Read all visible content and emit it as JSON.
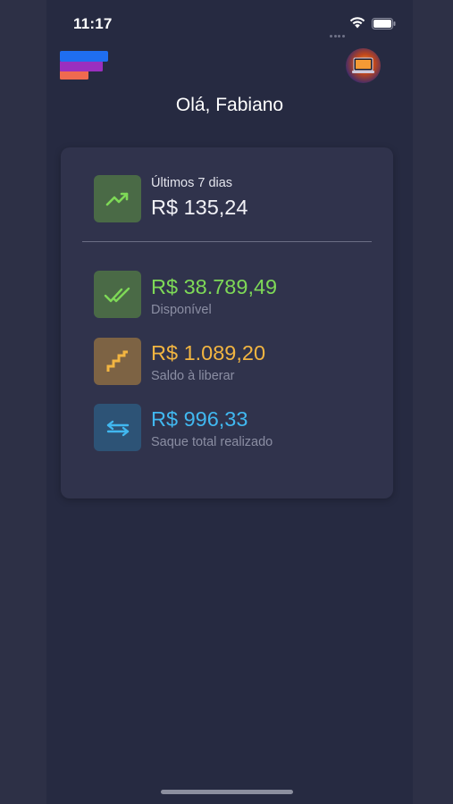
{
  "status_bar": {
    "time": "11:17"
  },
  "header": {
    "greeting": "Olá, Fabiano"
  },
  "summary": {
    "period_label": "Últimos 7 dias",
    "period_value": "R$ 135,24"
  },
  "balances": [
    {
      "value": "R$ 38.789,49",
      "label": "Disponível",
      "color": "#7ed957",
      "icon": "double-check-icon"
    },
    {
      "value": "R$ 1.089,20",
      "label": "Saldo à liberar",
      "color": "#f2b541",
      "icon": "stairs-icon"
    },
    {
      "value": "R$ 996,33",
      "label": "Saque total realizado",
      "color": "#41b8f0",
      "icon": "transfer-arrows-icon"
    }
  ]
}
